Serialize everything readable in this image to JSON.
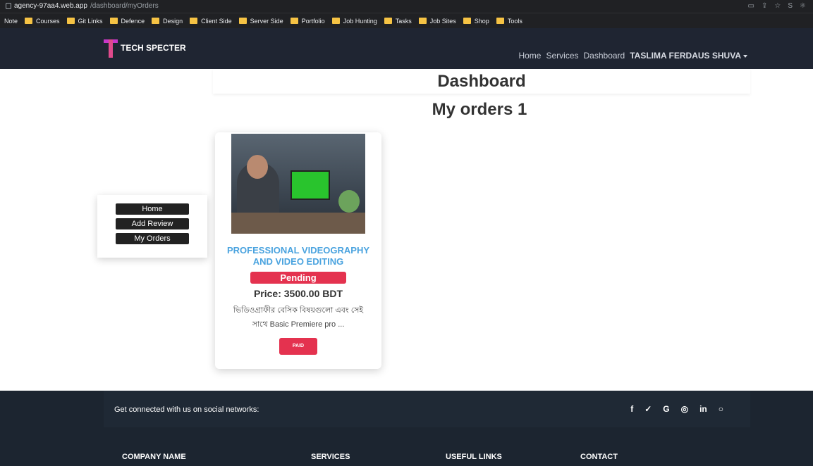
{
  "browser": {
    "host": "agency-97aa4.web.app",
    "path": "/dashboard/myOrders",
    "bookmarks": [
      "Note",
      "Courses",
      "Git Links",
      "Defence",
      "Design",
      "Client Side",
      "Server Side",
      "Portfolio",
      "Job Hunting",
      "Tasks",
      "Job Sites",
      "Shop",
      "Tools"
    ]
  },
  "navbar": {
    "brand": "TECH SPECTER",
    "links": [
      "Home",
      "Services",
      "Dashboard"
    ],
    "user": "TASLIMA FERDAUS SHUVA"
  },
  "main": {
    "dashboard_title": "Dashboard",
    "orders_title": "My orders 1"
  },
  "sidebar": {
    "items": [
      "Home",
      "Add Review",
      "My Orders"
    ]
  },
  "order": {
    "title": "PROFESSIONAL VIDEOGRAPHY AND VIDEO EDITING",
    "status": "Pending",
    "price": "Price: 3500.00 BDT",
    "description": "ভিডিওগ্রাফীর বেসিক বিষয়গুলো এবং সেই সাথে Basic Premiere pro ...",
    "action": "PAID"
  },
  "footer": {
    "social_text": "Get connected with us on social networks:",
    "social_icons": [
      "f",
      "✓",
      "G",
      "◎",
      "in",
      "○"
    ],
    "columns": [
      "COMPANY NAME",
      "SERVICES",
      "USEFUL LINKS",
      "CONTACT"
    ]
  },
  "colors": {
    "navbar": "#1f2532",
    "accent": "#e4324f",
    "title_blue": "#4aa3df"
  }
}
